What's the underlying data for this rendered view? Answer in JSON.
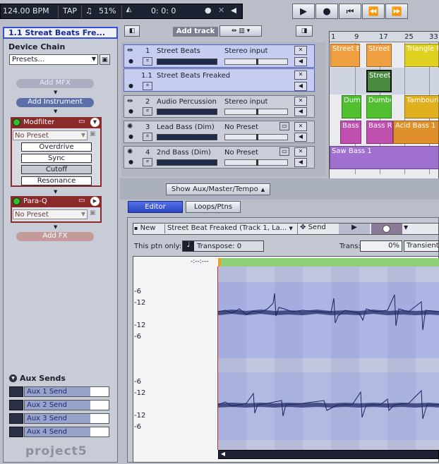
{
  "transport": {
    "bpm": "124.00 BPM",
    "tap": "TAP",
    "swing": "51%",
    "time": "0:  0:    0"
  },
  "device_panel": {
    "title": "1.1  Streat Beats Fre...",
    "device_chain_label": "Device Chain",
    "presets_value": "Presets...",
    "add_mfx": "Add MFX",
    "add_instrument": "Add Instrument",
    "modfilter": {
      "name": "Modfilter",
      "preset": "No Preset",
      "params": [
        "Overdrive",
        "Sync",
        "Cutoff",
        "Resonance"
      ]
    },
    "paraq": {
      "name": "Para-Q",
      "preset": "No Preset"
    },
    "add_fx": "Add FX",
    "aux_sends_label": "Aux Sends",
    "aux_sends": [
      {
        "label": "Aux 1 Send",
        "level": 0.78
      },
      {
        "label": "Aux 2 Send",
        "level": 0.78
      },
      {
        "label": "Aux 3 Send",
        "level": 0.78
      },
      {
        "label": "Aux 4 Send",
        "level": 0.78
      }
    ],
    "logo": "project5"
  },
  "tracks_header": {
    "add_track": "Add track"
  },
  "tracks": [
    {
      "num": "1",
      "name": "Street Beats",
      "input": "Stereo input",
      "selected": true
    },
    {
      "num": "1.1",
      "name": "Street Beats Freaked",
      "input": "",
      "selected": true
    },
    {
      "num": "2",
      "name": "Audio Percussion",
      "input": "Stereo input",
      "selected": false
    },
    {
      "num": "3",
      "name": "Lead Bass (Dim)",
      "input": "No Preset",
      "selected": false
    },
    {
      "num": "4",
      "name": "2nd Bass (Dim)",
      "input": "No Preset",
      "selected": false
    }
  ],
  "timeline": {
    "ruler": [
      "1",
      "9",
      "17",
      "25",
      "33"
    ],
    "clips": [
      {
        "label": "Street B",
        "color": "#f0a040"
      },
      {
        "label": "Street",
        "color": "#f0a040"
      },
      {
        "label": "Triangle F",
        "color": "#e0d020"
      },
      {
        "label": "Street",
        "color": "#4a8a40"
      },
      {
        "label": "Dum",
        "color": "#50c030"
      },
      {
        "label": "Dumbe",
        "color": "#50c030"
      },
      {
        "label": "Tambourine",
        "color": "#e0b020"
      },
      {
        "label": "Bass",
        "color": "#c050b0"
      },
      {
        "label": "Bass Ri",
        "color": "#c050b0"
      },
      {
        "label": "Acid Bass 1",
        "color": "#e0902a"
      },
      {
        "label": "Saw Bass 1",
        "color": "#a070d0"
      }
    ]
  },
  "show_aux_btn": "Show Aux/Master/Tempo",
  "tabs": {
    "editor": "Editor",
    "loops": "Loops/Ptns"
  },
  "editor": {
    "new_label": "New",
    "pattern_name": "Street Beat Freaked (Track 1, La...",
    "send_label": "Send",
    "this_ptn_only": "This ptn only:",
    "transpose_label": "Transpose: 0",
    "trans_label": "Trans:",
    "trans_value": "0%",
    "transient_label": "Transient",
    "time_readout": "-:--:---",
    "db_labels_top": [
      "-6",
      "-12",
      "-12",
      "-6"
    ],
    "db_labels_bottom": [
      "-6",
      "-12",
      "-12",
      "-6"
    ]
  },
  "colors": {
    "accent": "#3b4fd8",
    "selected_track": "#c6cdf1",
    "waveform": "#1a2360"
  }
}
